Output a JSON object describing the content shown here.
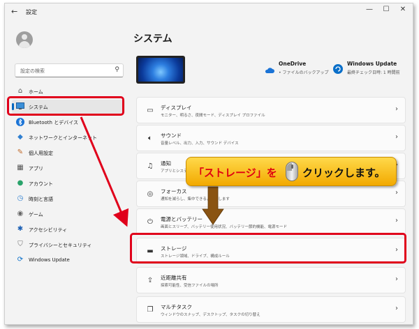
{
  "window": {
    "title": "設定",
    "back_glyph": "←",
    "controls": [
      "—",
      "☐",
      "✕"
    ]
  },
  "search": {
    "placeholder": "設定の検索"
  },
  "sidebar": {
    "items": [
      {
        "label": "ホーム",
        "icon": "home-icon"
      },
      {
        "label": "システム",
        "icon": "system-icon"
      },
      {
        "label": "Bluetooth とデバイス",
        "icon": "bluetooth-icon"
      },
      {
        "label": "ネットワークとインターネット",
        "icon": "network-icon"
      },
      {
        "label": "個人用設定",
        "icon": "brush-icon"
      },
      {
        "label": "アプリ",
        "icon": "apps-icon"
      },
      {
        "label": "アカウント",
        "icon": "account-icon"
      },
      {
        "label": "時刻と言語",
        "icon": "time-language-icon"
      },
      {
        "label": "ゲーム",
        "icon": "game-icon"
      },
      {
        "label": "アクセシビリティ",
        "icon": "accessibility-icon"
      },
      {
        "label": "プライバシーとセキュリティ",
        "icon": "shield-icon"
      },
      {
        "label": "Windows Update",
        "icon": "windows-update-icon"
      }
    ]
  },
  "main": {
    "title": "システム",
    "onedrive": {
      "title": "OneDrive",
      "subtitle": "• ファイルのバックアップ"
    },
    "windows_update": {
      "title": "Windows Update",
      "subtitle": "最終チェック日時: 1 時間前"
    },
    "cards": [
      {
        "title": "ディスプレイ",
        "subtitle": "モニター、明るさ、夜間モード、ディスプレイ プロファイル",
        "icon": "display-icon"
      },
      {
        "title": "サウンド",
        "subtitle": "音量レベル、出力、入力、サウンド デバイス",
        "icon": "speaker-icon"
      },
      {
        "title": "通知",
        "subtitle": "アプリとシステムからのアラート",
        "icon": "bell-icon"
      },
      {
        "title": "フォーカス",
        "subtitle": "通知を減らし、集中できるようにします",
        "icon": "focus-icon"
      },
      {
        "title": "電源とバッテリー",
        "subtitle": "画面とスリープ、バッテリー使用状況、バッテリー節約機能、電源モード",
        "icon": "power-icon"
      },
      {
        "title": "ストレージ",
        "subtitle": "ストレージ領域、ドライブ、構成ルール",
        "icon": "storage-icon"
      },
      {
        "title": "近距離共有",
        "subtitle": "探索可能性、受信ファイルの場所",
        "icon": "share-icon"
      },
      {
        "title": "マルチタスク",
        "subtitle": "ウィンドウのスナップ、デスクトップ、タスクの切り替え",
        "icon": "multitask-icon"
      }
    ]
  },
  "callout": {
    "part1": "「ストレージ」を",
    "part2": "クリックします。",
    "accent": "#e00010"
  },
  "colors": {
    "accent": "#0067c0",
    "highlight": "#e0001b",
    "callout_bg": "#f8c21a"
  }
}
